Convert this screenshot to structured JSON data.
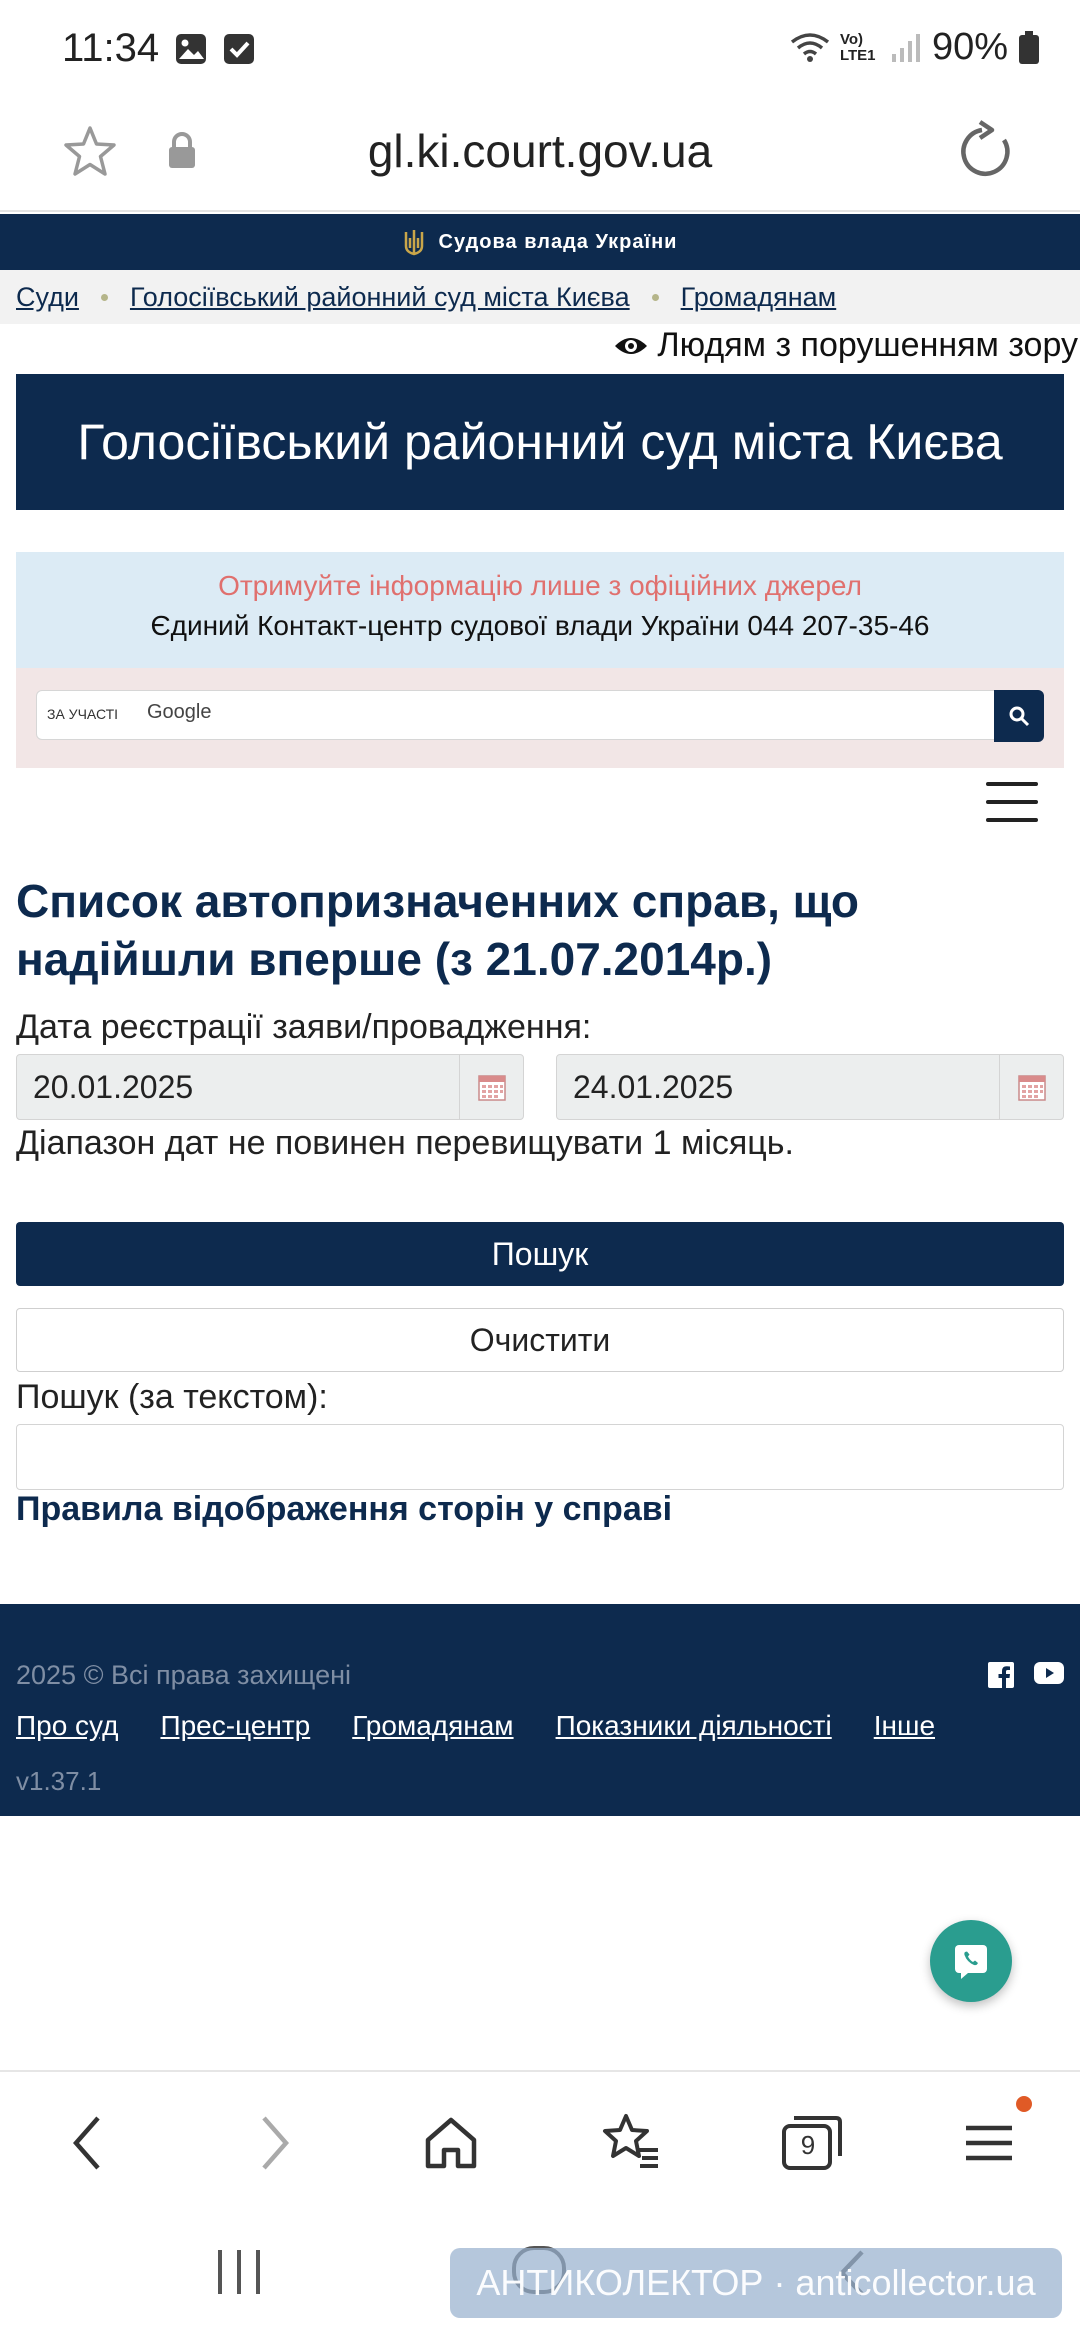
{
  "status_bar": {
    "time": "11:34",
    "network_label": "Vo) LTE1",
    "battery": "90%"
  },
  "browser": {
    "url": "gl.ki.court.gov.ua",
    "tab_count": "9"
  },
  "site": {
    "top_band": "Судова влада України",
    "breadcrumb": [
      "Суди",
      "Голосіївський районний суд міста Києва",
      "Громадянам"
    ],
    "accessibility_link": "Людям з порушенням зору",
    "court_title": "Голосіївський районний суд міста Києва",
    "info": {
      "warning": "Отримуйте інформацію лише з офіційних джерел",
      "contact": "Єдиний Контакт-центр судової влади України 044 207-35-46"
    },
    "google_search": {
      "label": "ЗА УЧАСТІ",
      "brand": "Google",
      "value": ""
    }
  },
  "form": {
    "title": "Список автопризначенних справ, що надійшли вперше (з 21.07.2014р.)",
    "date_label": "Дата реєстрації заяви/провадження:",
    "date_from": "20.01.2025",
    "date_to": "24.01.2025",
    "date_hint": "Діапазон дат не повинен перевищувати 1 місяць.",
    "search_button": "Пошук",
    "clear_button": "Очистити",
    "text_search_label": "Пошук (за текстом):",
    "text_search_value": "",
    "rules_link": "Правила відображення сторін у справі"
  },
  "footer": {
    "copyright": "2025 © Всі права захищені",
    "links": [
      "Про суд",
      "Прес-центр",
      "Громадянам",
      "Показники діяльності",
      "Інше"
    ],
    "version": "v1.37.1"
  },
  "watermark": "АНТИКОЛЕКТОР · anticollector.ua",
  "colors": {
    "brand_navy": "#0d2a4e",
    "warning_text": "#e0706e",
    "info_bg": "#dcebf5",
    "search_bg": "#f2e6e6",
    "call_button": "#2a9d8f",
    "notification_dot": "#e05a26"
  }
}
